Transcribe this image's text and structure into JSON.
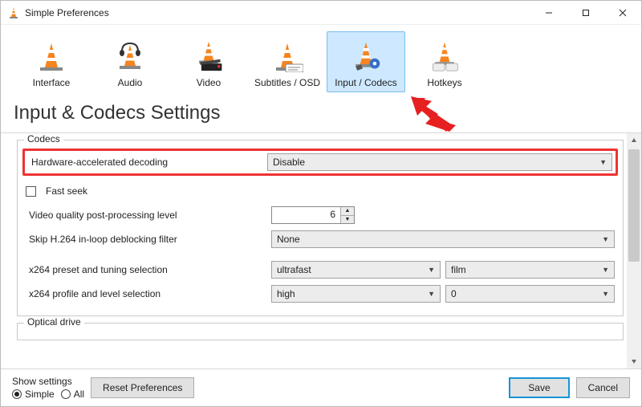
{
  "window": {
    "title": "Simple Preferences"
  },
  "categories": [
    {
      "key": "interface",
      "label": "Interface"
    },
    {
      "key": "audio",
      "label": "Audio"
    },
    {
      "key": "video",
      "label": "Video"
    },
    {
      "key": "subs",
      "label": "Subtitles / OSD"
    },
    {
      "key": "input",
      "label": "Input / Codecs",
      "selected": true
    },
    {
      "key": "hotkeys",
      "label": "Hotkeys"
    }
  ],
  "heading": "Input & Codecs Settings",
  "codecs_group": {
    "title": "Codecs",
    "hw_decode_label": "Hardware-accelerated decoding",
    "hw_decode_value": "Disable",
    "fast_seek_label": "Fast seek",
    "fast_seek_checked": false,
    "pp_level_label": "Video quality post-processing level",
    "pp_level_value": "6",
    "skip_loop_label": "Skip H.264 in-loop deblocking filter",
    "skip_loop_value": "None",
    "x264_preset_label": "x264 preset and tuning selection",
    "x264_preset_value": "ultrafast",
    "x264_tune_value": "film",
    "x264_profile_label": "x264 profile and level selection",
    "x264_profile_value": "high",
    "x264_level_value": "0"
  },
  "optical_group": {
    "title": "Optical drive"
  },
  "footer": {
    "show_settings_label": "Show settings",
    "radio_simple": "Simple",
    "radio_all": "All",
    "reset_label": "Reset Preferences",
    "save_label": "Save",
    "cancel_label": "Cancel"
  }
}
